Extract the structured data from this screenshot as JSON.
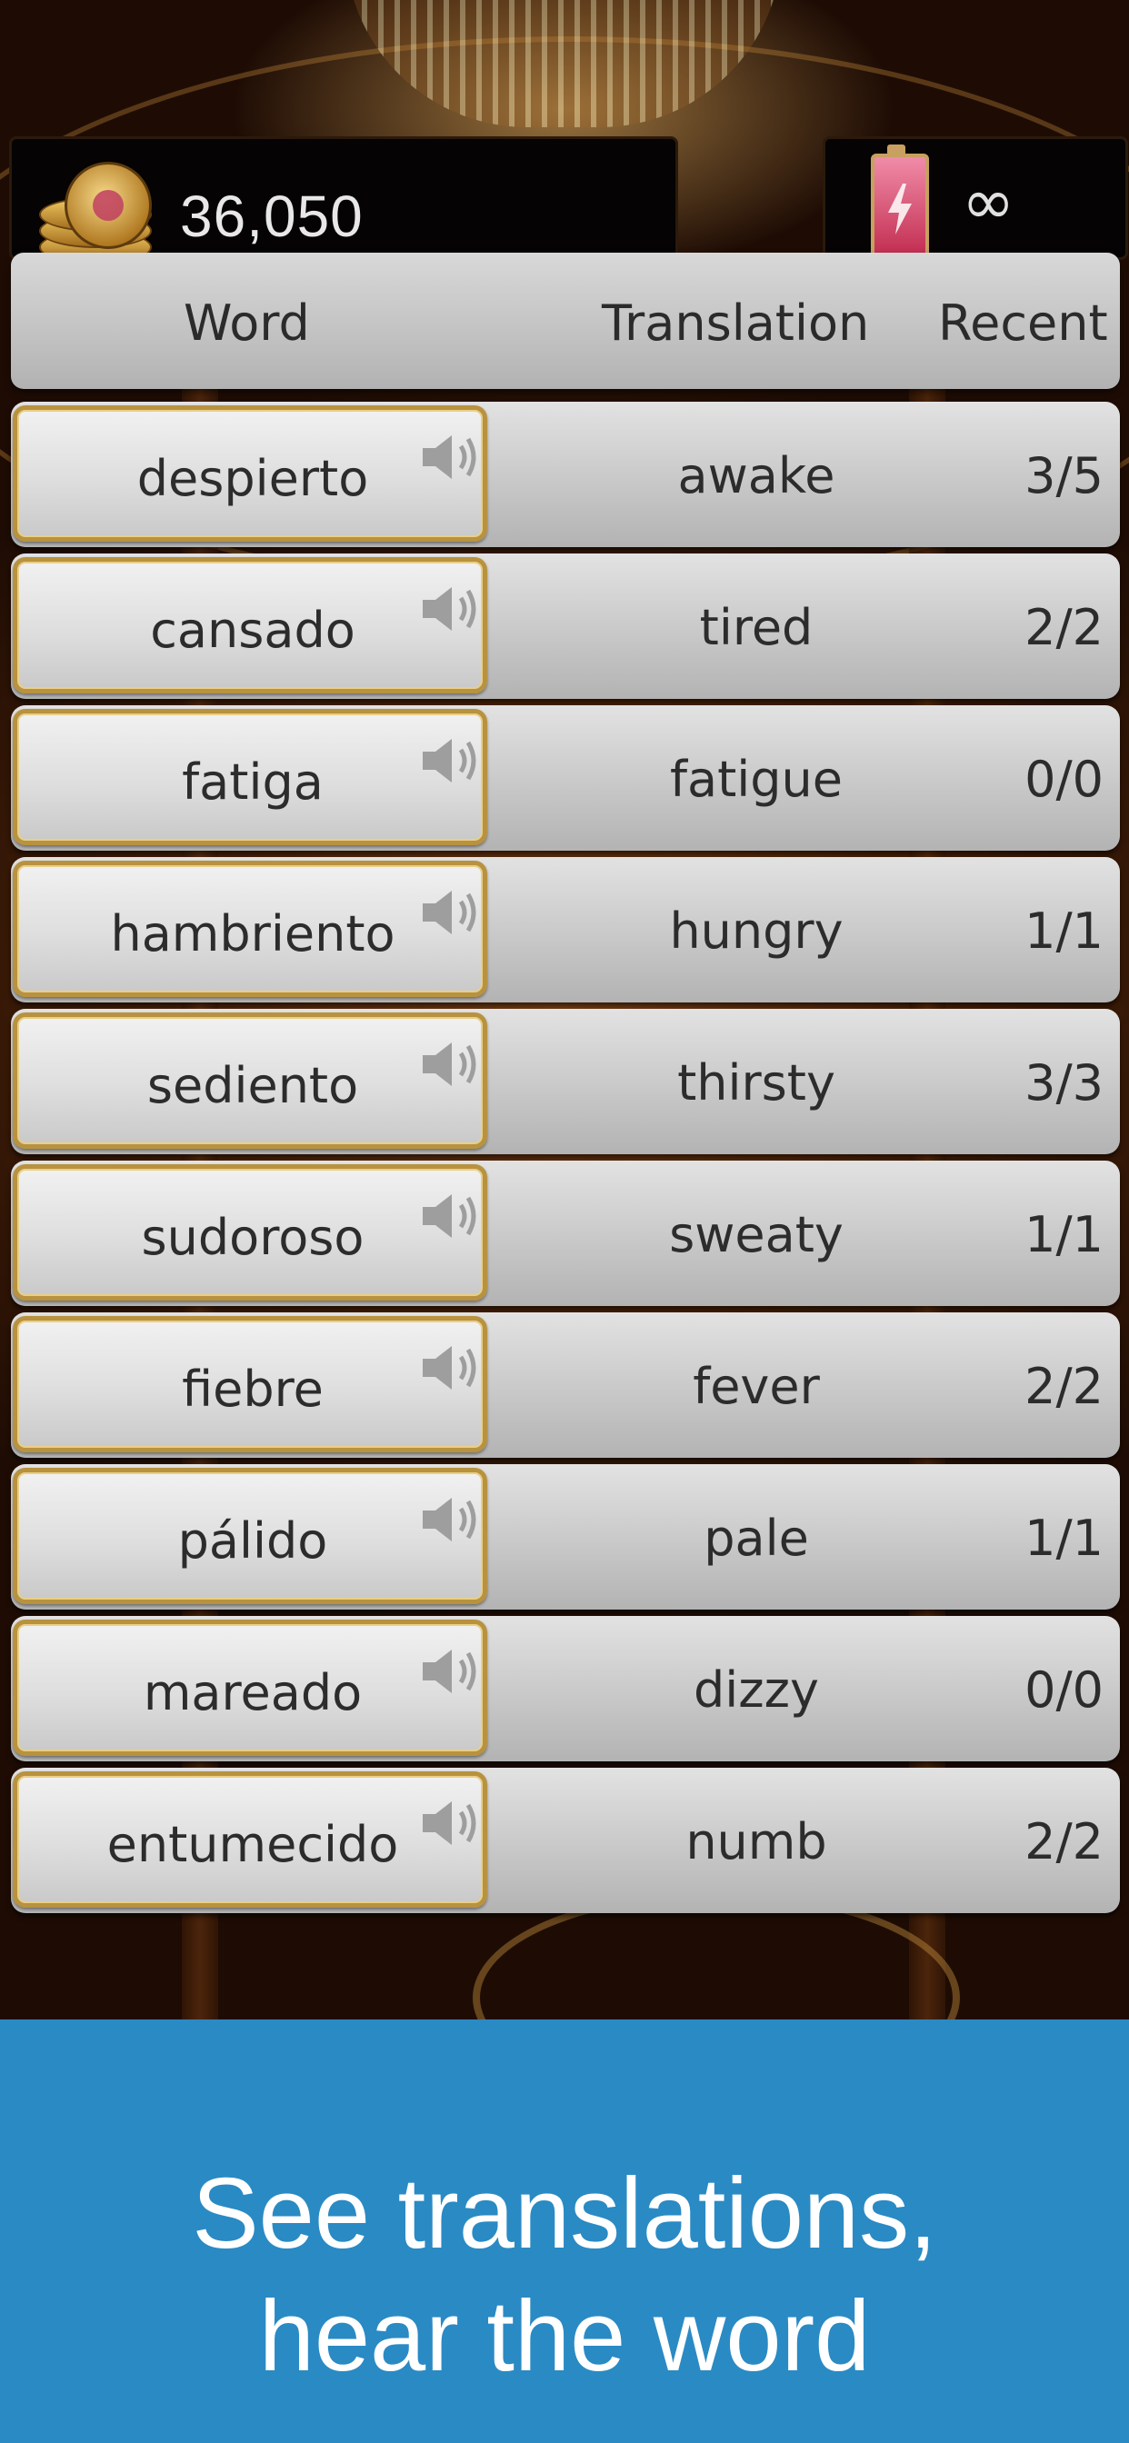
{
  "hud": {
    "coins": "36,050",
    "energy": "∞"
  },
  "table": {
    "headers": {
      "word": "Word",
      "translation": "Translation",
      "recent": "Recent"
    },
    "rows": [
      {
        "word": "despierto",
        "translation": "awake",
        "recent": "3/5"
      },
      {
        "word": "cansado",
        "translation": "tired",
        "recent": "2/2"
      },
      {
        "word": "fatiga",
        "translation": "fatigue",
        "recent": "0/0"
      },
      {
        "word": "hambriento",
        "translation": "hungry",
        "recent": "1/1"
      },
      {
        "word": "sediento",
        "translation": "thirsty",
        "recent": "3/3"
      },
      {
        "word": "sudoroso",
        "translation": "sweaty",
        "recent": "1/1"
      },
      {
        "word": "fiebre",
        "translation": "fever",
        "recent": "2/2"
      },
      {
        "word": "pálido",
        "translation": "pale",
        "recent": "1/1"
      },
      {
        "word": "mareado",
        "translation": "dizzy",
        "recent": "0/0"
      },
      {
        "word": "entumecido",
        "translation": "numb",
        "recent": "2/2"
      }
    ]
  },
  "banner": {
    "line1": "See translations,",
    "line2": "hear the word"
  },
  "colors": {
    "banner_bg": "#2a8ac4",
    "gold_border": "#b8923f"
  },
  "icons": {
    "coins": "coin-stack-icon",
    "energy": "battery-icon",
    "speaker": "speaker-icon"
  }
}
